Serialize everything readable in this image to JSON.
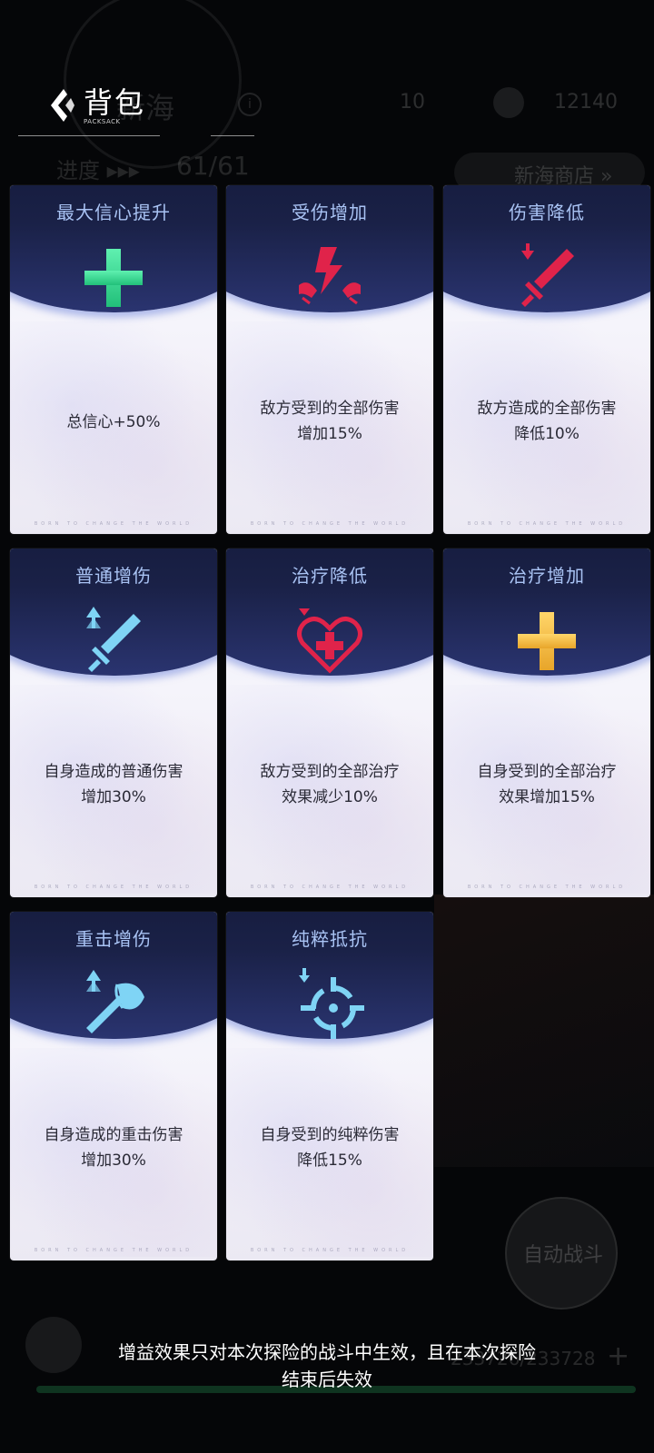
{
  "header": {
    "title": "背包",
    "subtitle": "PACKSACK"
  },
  "background": {
    "sea_title": "新海",
    "count": "10",
    "coins": "12140",
    "progress_label": "进度 ▸▸▸",
    "progress_value": "61/61",
    "shop_label": "新海商店 »",
    "auto_battle_label": "自动战斗",
    "hp_text": "233726/233728"
  },
  "cards": [
    {
      "title": "最大信心提升",
      "desc": [
        "总信心+50%"
      ],
      "icon": "green-plus-icon",
      "color": "#3fe29a"
    },
    {
      "title": "受伤增加",
      "desc": [
        "敌方受到的全部伤害",
        "增加15%"
      ],
      "icon": "broken-shield-icon",
      "color": "#e0234a"
    },
    {
      "title": "伤害降低",
      "desc": [
        "敌方造成的全部伤害",
        "降低10%"
      ],
      "icon": "sword-down-icon",
      "color": "#e0234a"
    },
    {
      "title": "普通增伤",
      "desc": [
        "自身造成的普通伤害",
        "增加30%"
      ],
      "icon": "sword-up-icon",
      "color": "#7fd4f5"
    },
    {
      "title": "治疗降低",
      "desc": [
        "敌方受到的全部治疗",
        "效果减少10%"
      ],
      "icon": "heart-down-icon",
      "color": "#e0234a"
    },
    {
      "title": "治疗增加",
      "desc": [
        "自身受到的全部治疗",
        "效果增加15%"
      ],
      "icon": "yellow-plus-icon",
      "color": "#f1b93a"
    },
    {
      "title": "重击增伤",
      "desc": [
        "自身造成的重击伤害",
        "增加30%"
      ],
      "icon": "axe-up-icon",
      "color": "#7fd4f5"
    },
    {
      "title": "纯粹抵抗",
      "desc": [
        "自身受到的纯粹伤害",
        "降低15%"
      ],
      "icon": "crosshair-down-icon",
      "color": "#7fd4f5"
    }
  ],
  "card_footer": "BORN TO CHANGE THE WORLD",
  "footer_note": [
    "增益效果只对本次探险的战斗中生效，且在本次探险",
    "结束后失效"
  ]
}
